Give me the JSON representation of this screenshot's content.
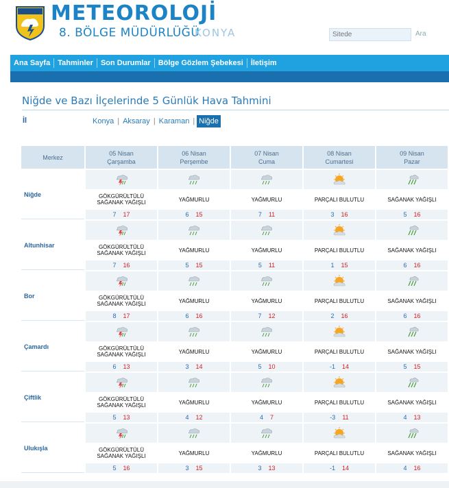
{
  "header": {
    "brand_title": "METEOROLOJİ",
    "brand_subtitle": "8. BÖLGE MÜDÜRLÜĞÜ",
    "brand_city": "KONYA",
    "logo_text": "METEOROLOJİ",
    "search_placeholder": "Sitede",
    "search_button": "Ara"
  },
  "nav": {
    "items": [
      {
        "label": "Ana Sayfa"
      },
      {
        "label": "Tahminler"
      },
      {
        "label": "Son Durumlar"
      },
      {
        "label": "Bölge Gözlem Şebekesi"
      },
      {
        "label": "İletişim"
      }
    ]
  },
  "page": {
    "title": "Niğde ve Bazı İlçelerinde 5 Günlük Hava Tahmini",
    "il_label": "İl",
    "city_links": [
      "Konya",
      "Aksaray",
      "Karaman",
      "Niğde"
    ],
    "active_city": "Niğde"
  },
  "table": {
    "merkez_header": "Merkez",
    "days": [
      {
        "date": "05 Nisan",
        "weekday": "Çarşamba"
      },
      {
        "date": "06 Nisan",
        "weekday": "Perşembe"
      },
      {
        "date": "07 Nisan",
        "weekday": "Cuma"
      },
      {
        "date": "08 Nisan",
        "weekday": "Cumartesi"
      },
      {
        "date": "09 Nisan",
        "weekday": "Pazar"
      }
    ],
    "stations": [
      {
        "name": "Niğde",
        "forecasts": [
          {
            "icon": "thunder-rain-icon",
            "desc1": "GÖKGÜRÜLTÜLÜ",
            "desc2": "SAĞANAK YAĞIŞLI",
            "min": "7",
            "max": "17"
          },
          {
            "icon": "rain-icon",
            "desc1": "YAĞMURLU",
            "desc2": "",
            "min": "6",
            "max": "15"
          },
          {
            "icon": "rain-icon",
            "desc1": "YAĞMURLU",
            "desc2": "",
            "min": "7",
            "max": "11"
          },
          {
            "icon": "partly-cloudy-icon",
            "desc1": "PARÇALI BULUTLU",
            "desc2": "",
            "min": "3",
            "max": "16"
          },
          {
            "icon": "shower-icon",
            "desc1": "SAĞANAK YAĞIŞLI",
            "desc2": "",
            "min": "5",
            "max": "16"
          }
        ]
      },
      {
        "name": "Altunhisar",
        "forecasts": [
          {
            "icon": "thunder-rain-icon",
            "desc1": "GÖKGÜRÜLTÜLÜ",
            "desc2": "SAĞANAK YAĞIŞLI",
            "min": "7",
            "max": "16"
          },
          {
            "icon": "rain-icon",
            "desc1": "YAĞMURLU",
            "desc2": "",
            "min": "5",
            "max": "15"
          },
          {
            "icon": "rain-icon",
            "desc1": "YAĞMURLU",
            "desc2": "",
            "min": "5",
            "max": "11"
          },
          {
            "icon": "partly-cloudy-icon",
            "desc1": "PARÇALI BULUTLU",
            "desc2": "",
            "min": "1",
            "max": "15"
          },
          {
            "icon": "shower-icon",
            "desc1": "SAĞANAK YAĞIŞLI",
            "desc2": "",
            "min": "6",
            "max": "16"
          }
        ]
      },
      {
        "name": "Bor",
        "forecasts": [
          {
            "icon": "thunder-rain-icon",
            "desc1": "GÖKGÜRÜLTÜLÜ",
            "desc2": "SAĞANAK YAĞIŞLI",
            "min": "8",
            "max": "17"
          },
          {
            "icon": "rain-icon",
            "desc1": "YAĞMURLU",
            "desc2": "",
            "min": "6",
            "max": "16"
          },
          {
            "icon": "rain-icon",
            "desc1": "YAĞMURLU",
            "desc2": "",
            "min": "7",
            "max": "12"
          },
          {
            "icon": "partly-cloudy-icon",
            "desc1": "PARÇALI BULUTLU",
            "desc2": "",
            "min": "2",
            "max": "16"
          },
          {
            "icon": "shower-icon",
            "desc1": "SAĞANAK YAĞIŞLI",
            "desc2": "",
            "min": "6",
            "max": "16"
          }
        ]
      },
      {
        "name": "Çamardı",
        "forecasts": [
          {
            "icon": "thunder-rain-icon",
            "desc1": "GÖKGÜRÜLTÜLÜ",
            "desc2": "SAĞANAK YAĞIŞLI",
            "min": "6",
            "max": "13"
          },
          {
            "icon": "rain-icon",
            "desc1": "YAĞMURLU",
            "desc2": "",
            "min": "3",
            "max": "14"
          },
          {
            "icon": "rain-icon",
            "desc1": "YAĞMURLU",
            "desc2": "",
            "min": "5",
            "max": "10"
          },
          {
            "icon": "partly-cloudy-icon",
            "desc1": "PARÇALI BULUTLU",
            "desc2": "",
            "min": "-1",
            "max": "14"
          },
          {
            "icon": "shower-icon",
            "desc1": "SAĞANAK YAĞIŞLI",
            "desc2": "",
            "min": "5",
            "max": "15"
          }
        ]
      },
      {
        "name": "Çiftlik",
        "forecasts": [
          {
            "icon": "thunder-rain-icon",
            "desc1": "GÖKGÜRÜLTÜLÜ",
            "desc2": "SAĞANAK YAĞIŞLI",
            "min": "5",
            "max": "13"
          },
          {
            "icon": "rain-icon",
            "desc1": "YAĞMURLU",
            "desc2": "",
            "min": "4",
            "max": "12"
          },
          {
            "icon": "rain-icon",
            "desc1": "YAĞMURLU",
            "desc2": "",
            "min": "4",
            "max": "7"
          },
          {
            "icon": "partly-cloudy-icon",
            "desc1": "PARÇALI BULUTLU",
            "desc2": "",
            "min": "-3",
            "max": "11"
          },
          {
            "icon": "shower-icon",
            "desc1": "SAĞANAK YAĞIŞLI",
            "desc2": "",
            "min": "4",
            "max": "13"
          }
        ]
      },
      {
        "name": "Ulukışla",
        "forecasts": [
          {
            "icon": "thunder-rain-icon",
            "desc1": "GÖKGÜRÜLTÜLÜ",
            "desc2": "SAĞANAK YAĞIŞLI",
            "min": "5",
            "max": "16"
          },
          {
            "icon": "rain-icon",
            "desc1": "YAĞMURLU",
            "desc2": "",
            "min": "3",
            "max": "15"
          },
          {
            "icon": "rain-icon",
            "desc1": "YAĞMURLU",
            "desc2": "",
            "min": "3",
            "max": "13"
          },
          {
            "icon": "partly-cloudy-icon",
            "desc1": "PARÇALI BULUTLU",
            "desc2": "",
            "min": "-1",
            "max": "14"
          },
          {
            "icon": "shower-icon",
            "desc1": "SAĞANAK YAĞIŞLI",
            "desc2": "",
            "min": "4",
            "max": "16"
          }
        ]
      }
    ]
  },
  "colors": {
    "brand_blue": "#1c84c6",
    "nav_blue": "#1fa2df",
    "nav_dark": "#1a6fae",
    "min_temp": "#2a6bb0",
    "max_temp": "#d42020"
  }
}
